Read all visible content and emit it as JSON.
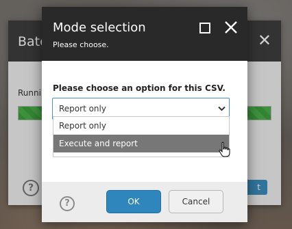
{
  "background_dialog": {
    "title": "Batc",
    "status_text": "Runnin",
    "button_label_partial": "t",
    "progress": 1.0,
    "progress_color": "#3fa33f",
    "header_color": "#3f3f3f"
  },
  "modal": {
    "title": "Mode selection",
    "subtitle": "Please choose.",
    "header_color": "#292929",
    "prompt": "Please choose an option for this CSV.",
    "select": {
      "selected_value": "Report only",
      "options": [
        "Report only",
        "Execute and report"
      ],
      "highlighted_option": "Execute and report"
    },
    "ok_label": "OK",
    "cancel_label": "Cancel",
    "accent_color": "#2f86bd"
  },
  "icons": {
    "help": "help-icon",
    "maximize": "maximize-icon",
    "close": "close-icon",
    "chevron": "chevron-down-icon",
    "cursor": "hand-pointer-icon"
  }
}
